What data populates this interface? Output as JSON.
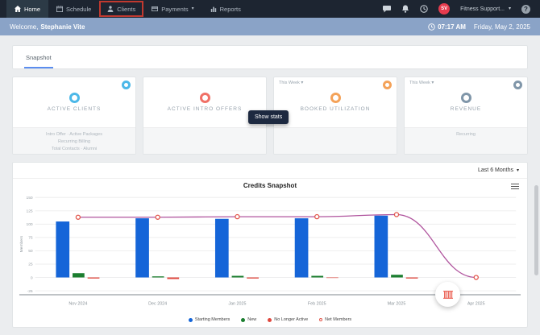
{
  "nav": {
    "items": [
      {
        "label": "Home",
        "icon": "home-icon",
        "active": true
      },
      {
        "label": "Schedule",
        "icon": "calendar-icon"
      },
      {
        "label": "Clients",
        "icon": "person-icon",
        "highlighted": true
      },
      {
        "label": "Payments",
        "icon": "card-icon",
        "caret": true
      },
      {
        "label": "Reports",
        "icon": "bar-chart-icon"
      }
    ],
    "account": {
      "avatar_initials": "SV",
      "name": "Fitness Support..."
    }
  },
  "welcome": {
    "greeting": "Welcome,",
    "user_name": "Stephanie Vite",
    "time": "07:17 AM",
    "date": "Friday, May 2, 2025"
  },
  "tabs": {
    "items": [
      {
        "label": "Snapshot",
        "active": true
      }
    ]
  },
  "cards": [
    {
      "title": "ACTIVE CLIENTS",
      "accent": "#4cb8e8",
      "period": "",
      "has_action": true,
      "footer_lines": [
        "Intro Offer · Active Packages",
        "Recurring Billing",
        "Total Contacts · Alumni"
      ]
    },
    {
      "title": "ACTIVE INTRO OFFERS",
      "accent": "#f07066",
      "period": "",
      "has_action": false,
      "footer_lines": []
    },
    {
      "title": "BOOKED UTILIZATION",
      "accent": "#f4a259",
      "period": "This Week",
      "has_action": true,
      "footer_lines": []
    },
    {
      "title": "REVENUE",
      "accent": "#8096a9",
      "period": "This Week",
      "has_action": true,
      "footer_lines": [
        "Recurring"
      ]
    }
  ],
  "show_stats_label": "Show stats",
  "chart_panel": {
    "range_label": "Last 6 Months",
    "title": "Credits Snapshot"
  },
  "chart_data": {
    "type": "bar+line",
    "title": "Credits Snapshot",
    "ylabel": "Members",
    "ylim": [
      -25,
      150
    ],
    "yticks": [
      150,
      125,
      100,
      75,
      50,
      25,
      0,
      -25
    ],
    "grid": true,
    "legend_position": "bottom",
    "categories": [
      "Nov 2024",
      "Dec 2024",
      "Jan 2025",
      "Feb 2025",
      "Mar 2025",
      "Apr 2025"
    ],
    "series": [
      {
        "name": "Starting Members",
        "type": "bar",
        "color": "#1565d8",
        "values": [
          105,
          111,
          110,
          111,
          116,
          0
        ]
      },
      {
        "name": "New",
        "type": "bar",
        "color": "#1b7e2f",
        "values": [
          8,
          2,
          3,
          3,
          5,
          0
        ]
      },
      {
        "name": "No Longer Active",
        "type": "bar",
        "color": "#e0483e",
        "values": [
          -2,
          -3,
          -2,
          -1,
          -2,
          0
        ]
      },
      {
        "name": "Net Members",
        "type": "line",
        "color": "#b0559e",
        "marker_color": "#e2574c",
        "values": [
          113,
          113,
          114,
          114,
          118,
          0
        ]
      }
    ]
  },
  "colors": {
    "nav_bg": "#1d2531",
    "nav_active_bg": "#2c3a46",
    "highlight_box": "#c0392f",
    "welcome_bg": "#8aa3c7",
    "avatar_bg": "#e63b4e",
    "tab_underline": "#5b8def",
    "show_stats_bg": "#1d2940"
  }
}
